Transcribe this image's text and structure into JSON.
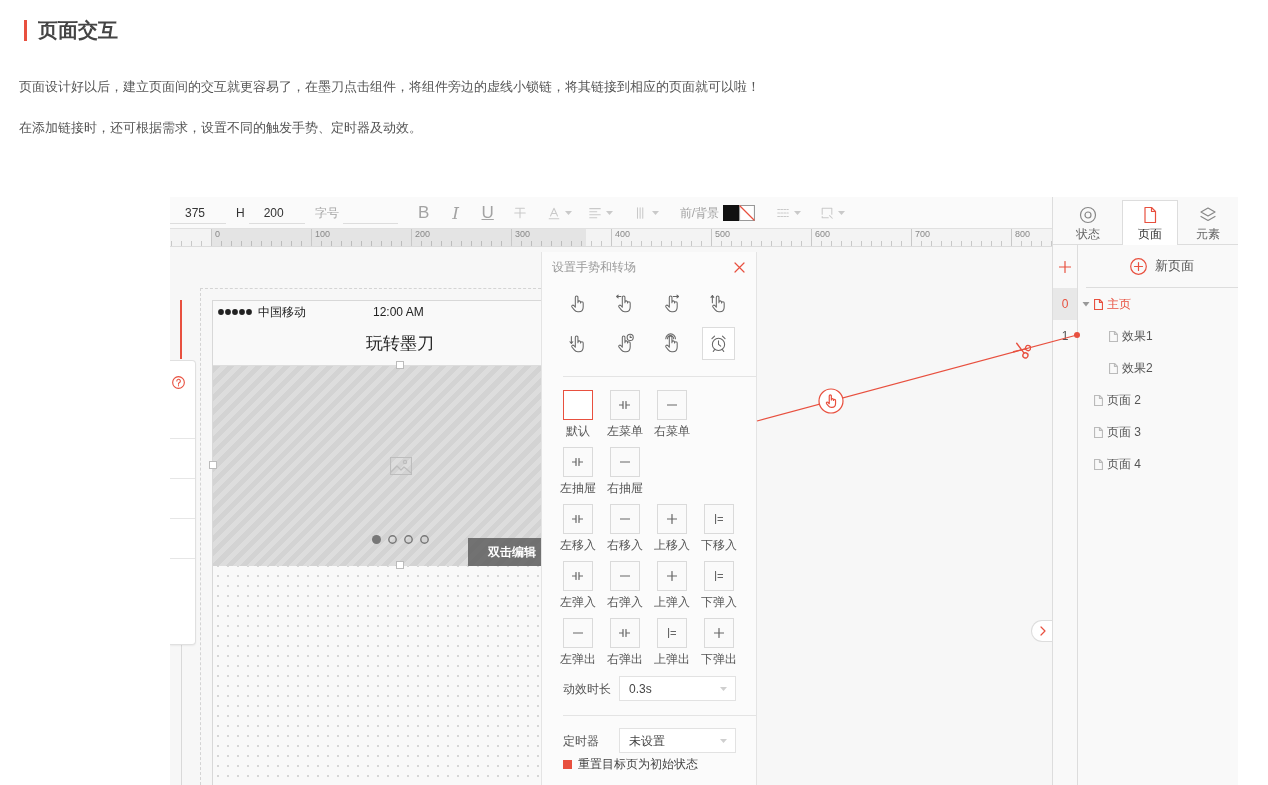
{
  "article": {
    "heading": "页面交互",
    "paragraphs": [
      "页面设计好以后，建立页面间的交互就更容易了，在墨刀点击组件，将组件旁边的虚线小锁链，将其链接到相应的页面就可以啦！",
      "在添加链接时，还可根据需求，设置不同的触发手势、定时器及动效。"
    ]
  },
  "toolbar": {
    "width_value": "375",
    "height_label": "H",
    "height_value": "200",
    "text_format": {
      "disabled": true,
      "font_size_label": "字号",
      "style_buttons": [
        "B",
        "I",
        "U"
      ],
      "color_label": "前/背景"
    }
  },
  "ruler": {
    "labels": [
      "0",
      "100",
      "200",
      "300",
      "400",
      "500",
      "600",
      "700",
      "800"
    ]
  },
  "phone": {
    "carrier": "中国移动",
    "time": "12:00 AM",
    "title": "玩转墨刀",
    "carousel_dots": [
      {
        "selected": true
      },
      {
        "selected": false
      },
      {
        "selected": false
      },
      {
        "selected": false
      }
    ],
    "overlay_text": "双击编辑"
  },
  "gesture_panel": {
    "title": "设置手势和转场",
    "gestures": [
      {
        "kind": "tap",
        "selected": false
      },
      {
        "kind": "left",
        "selected": false
      },
      {
        "kind": "right",
        "selected": false
      },
      {
        "kind": "up",
        "selected": false
      },
      {
        "kind": "down",
        "selected": false
      },
      {
        "kind": "hold",
        "selected": false
      },
      {
        "kind": "press",
        "selected": false
      },
      {
        "kind": "timer",
        "selected": true
      }
    ],
    "transition_rows": [
      {
        "items": [
          {
            "label": "默认",
            "kind": "blank",
            "selected": true
          },
          {
            "label": "左菜单",
            "kind": "bars",
            "selected": false
          },
          {
            "label": "右菜单",
            "kind": "dash",
            "selected": false
          }
        ]
      },
      {
        "items": [
          {
            "label": "左抽屉",
            "kind": "bars",
            "selected": false
          },
          {
            "label": "右抽屉",
            "kind": "dash",
            "selected": false
          }
        ]
      },
      {
        "items": [
          {
            "label": "左移入",
            "kind": "bars",
            "selected": false
          },
          {
            "label": "右移入",
            "kind": "dash",
            "selected": false
          },
          {
            "label": "上移入",
            "kind": "plus",
            "selected": false
          },
          {
            "label": "下移入",
            "kind": "rule",
            "selected": false
          }
        ]
      },
      {
        "items": [
          {
            "label": "左弹入",
            "kind": "bars",
            "selected": false
          },
          {
            "label": "右弹入",
            "kind": "dash",
            "selected": false
          },
          {
            "label": "上弹入",
            "kind": "plus",
            "selected": false
          },
          {
            "label": "下弹入",
            "kind": "rule",
            "selected": false
          }
        ]
      },
      {
        "items": [
          {
            "label": "左弹出",
            "kind": "dash",
            "selected": false
          },
          {
            "label": "右弹出",
            "kind": "bars",
            "selected": false
          },
          {
            "label": "上弹出",
            "kind": "rule",
            "selected": false
          },
          {
            "label": "下弹出",
            "kind": "plus",
            "selected": false
          }
        ]
      }
    ],
    "duration": {
      "label": "动效时长",
      "value": "0.3s"
    },
    "timer": {
      "label": "定时器",
      "value": "未设置"
    },
    "reset_option": {
      "label": "重置目标页为初始状态",
      "checked": true
    }
  },
  "side_panel": {
    "tabs": [
      {
        "label": "状态",
        "kind": "states",
        "selected": false
      },
      {
        "label": "页面",
        "kind": "pages",
        "selected": true
      },
      {
        "label": "元素",
        "kind": "layers",
        "selected": false
      }
    ],
    "new_page_label": "新页面",
    "row_numbers": [
      {
        "label": "0",
        "selected": true
      },
      {
        "label": "1",
        "selected": false
      }
    ],
    "pages": [
      {
        "label": "主页",
        "selected": true,
        "expanded": true,
        "children": [
          {
            "label": "效果1",
            "selected": false
          },
          {
            "label": "效果2",
            "selected": false
          }
        ]
      },
      {
        "label": "页面 2",
        "selected": false
      },
      {
        "label": "页面 3",
        "selected": false
      },
      {
        "label": "页面 4",
        "selected": false
      }
    ]
  }
}
